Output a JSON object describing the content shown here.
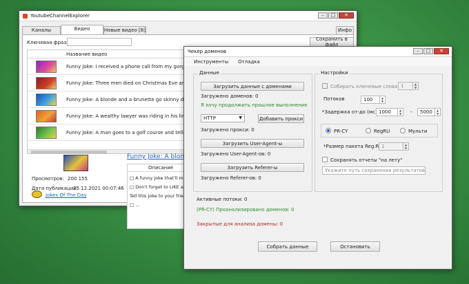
{
  "main": {
    "title": "YoutubeChannelExplorer",
    "tabs": [
      "Каналы",
      "Видео",
      "Новые видео [8]"
    ],
    "info_tab": "Инфо",
    "keyword_label": "Ключевая фраза:",
    "save_button": "Сохранить в файл",
    "grid_header": "Название видео",
    "rows": [
      "Funny Joke: I received a phone call from my gorgeous ex",
      "Funny Joke: Three men died on Christmas Eve and were m",
      "Funny Joke: A blonde and a brunette go skinny dipping, w",
      "Funny Joke: A wealthy lawyer was riding in his limousine wh",
      "Funny Joke: A man goes to a golf course and tells the club"
    ],
    "video_title": "Funny Joke: A blonde a",
    "views_label": "Просмотров:",
    "views_value": "200 155",
    "published_label": "Дата публикации:",
    "published_value": "25.12.2021 00:07:46",
    "channel_name": "Jokes Of The Day",
    "description_header": "Описание",
    "description_lines": [
      "□ A funny joke that'll make",
      "□ Don't forget to LIKE and",
      "Tell this joke to your friend",
      "□ ..."
    ]
  },
  "checker": {
    "title": "Чекер доменов",
    "menu": [
      "Инструменты",
      "Отладка"
    ],
    "data_group": "Данные",
    "load_domains_button": "Загрузить данные с доменами",
    "domains_loaded": "Загружено доменов: 0",
    "continue_prev": "Я хочу продолжить прошлое выполнение",
    "proxy_type": "HTTP",
    "add_proxy_button": "Добавить прокси",
    "proxies_loaded": "Загружено прокси: 0",
    "load_useragent_button": "Загрузить User-Agent-ы",
    "useragents_loaded": "Загружено User-Agent-ов: 0",
    "load_referer_button": "Загрузить Referer-ы",
    "referers_loaded": "Загружено Referer-ов: 0",
    "settings_group": "Настройки",
    "collect_keywords": "Собирать ключевые слова",
    "collect_keywords_value": "1",
    "threads_label": "Потоков",
    "threads_value": "100",
    "delay_label": "*Задержка от-до (мс)",
    "delay_from": "1000",
    "delay_sep": "-",
    "delay_to": "5000",
    "radio_options": [
      "PR-CY",
      "RegRU",
      "Мульти"
    ],
    "radio_selected": "PR-CY",
    "regru_packet_label": "*Размер пакета Reg.Ru",
    "regru_packet_value": "1",
    "save_reports": "Сохранять отчеты \"на лету\"",
    "save_path_placeholder": "Укажите путь сохранения результатов",
    "active_threads": "Активные потоки: 0",
    "analyzed": "(PR-CY) Проанализировано доменов: 0",
    "closed": "Закрытые для анализа домены: 0",
    "collect_button": "Собрать данные",
    "stop_button": "Остановить"
  },
  "colors": {
    "desktop": "#3a9145",
    "status_green": "#2b8a2b",
    "status_red": "#b02727",
    "link": "#1f5fbf"
  }
}
